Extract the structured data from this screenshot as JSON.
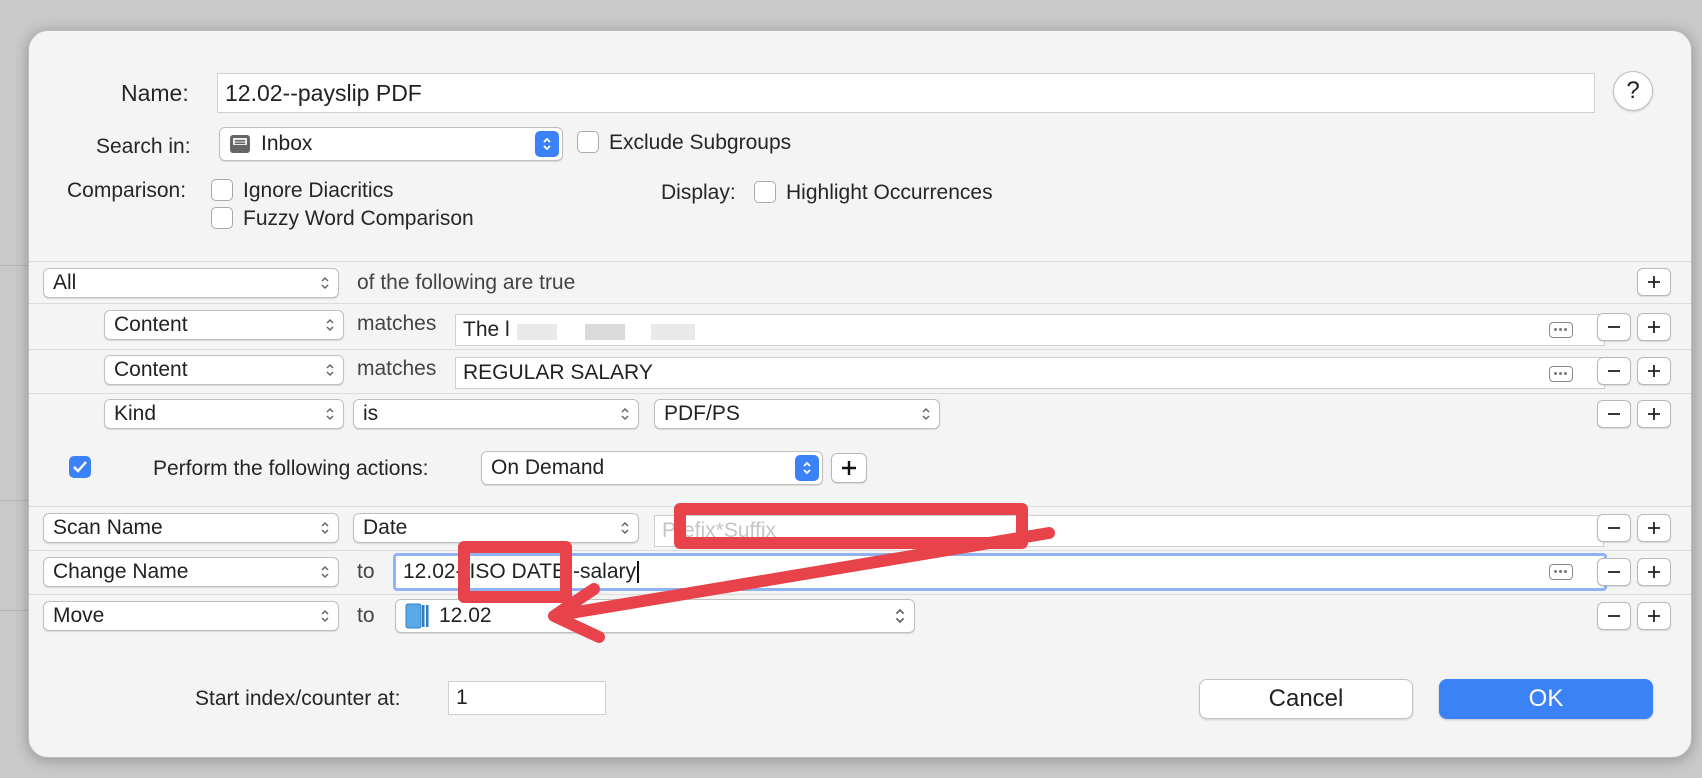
{
  "colors": {
    "accent": "#3b82f6",
    "annotation": "#e8434a"
  },
  "header": {
    "name_label": "Name:",
    "name_value": "12.02--payslip PDF",
    "help_label": "?",
    "search_in_label": "Search in:",
    "search_in_value": "Inbox",
    "exclude_subgroups": "Exclude Subgroups",
    "comparison_label": "Comparison:",
    "ignore_diacritics": "Ignore Diacritics",
    "fuzzy_word": "Fuzzy Word Comparison",
    "display_label": "Display:",
    "highlight_occurrences": "Highlight Occurrences"
  },
  "criteria": {
    "mode": "All",
    "mode_text": "of the following are true",
    "rows": [
      {
        "field": "Content",
        "op": "matches",
        "value": "The l"
      },
      {
        "field": "Content",
        "op": "matches",
        "value": "REGULAR SALARY"
      },
      {
        "field": "Kind",
        "op": "is",
        "value": "PDF/PS"
      }
    ]
  },
  "actions_header": {
    "perform_label": "Perform the following actions:",
    "trigger": "On Demand"
  },
  "actions": [
    {
      "action": "Scan Name",
      "param": "Date",
      "placeholder": "Prefix*Suffix"
    },
    {
      "action": "Change Name",
      "to": "to",
      "value": "12.02--ISO DATE--salary"
    },
    {
      "action": "Move",
      "to": "to",
      "group": "12.02"
    }
  ],
  "footer": {
    "start_index_label": "Start index/counter at:",
    "start_index_value": "1",
    "cancel": "Cancel",
    "ok": "OK"
  }
}
